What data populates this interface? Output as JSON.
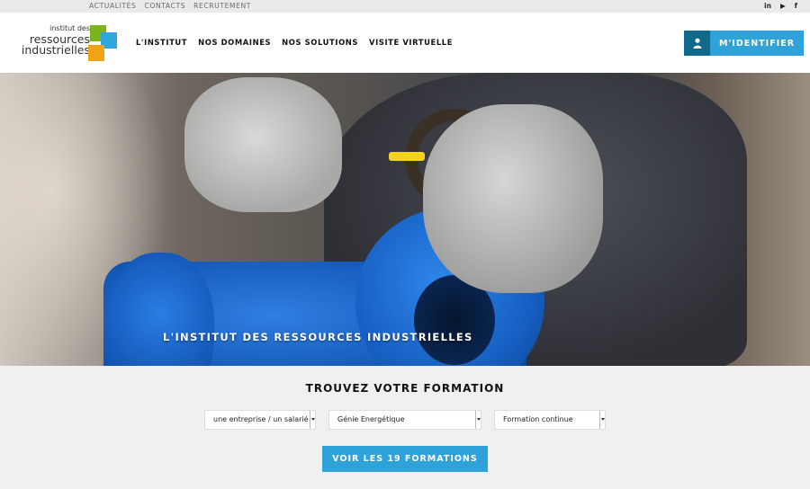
{
  "topbar": {
    "links": [
      "ACTUALITÉS",
      "CONTACTS",
      "RECRUTEMENT"
    ],
    "social": [
      {
        "name": "linkedin-icon",
        "glyph": "in"
      },
      {
        "name": "youtube-icon",
        "glyph": "▶"
      },
      {
        "name": "facebook-icon",
        "glyph": "f"
      }
    ]
  },
  "header": {
    "logo": {
      "line1": "institut des",
      "line2": "ressources",
      "line3": "industrielles"
    },
    "nav": [
      "L'INSTITUT",
      "NOS DOMAINES",
      "NOS SOLUTIONS",
      "VISITE VIRTUELLE"
    ],
    "login_label": "M'IDENTIFIER"
  },
  "hero": {
    "title": "L'INSTITUT DES RESSOURCES INDUSTRIELLES"
  },
  "search": {
    "title": "TROUVEZ VOTRE FORMATION",
    "selects": [
      "une entreprise / un salarié",
      "Génie Energétique",
      "Formation continue"
    ],
    "cta_label": "VOIR LES 19 FORMATIONS"
  },
  "colors": {
    "accent": "#2fa3d9",
    "accent_dark": "#0f6a8c",
    "logo_green": "#7ab41e",
    "logo_blue": "#2fa6df",
    "logo_orange": "#f0a316"
  }
}
